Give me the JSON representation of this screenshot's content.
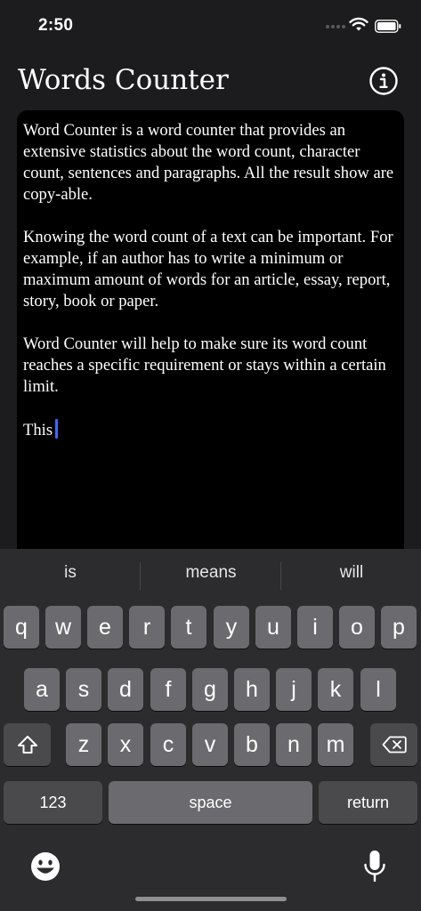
{
  "status_bar": {
    "time": "2:50"
  },
  "header": {
    "title": "Words Counter",
    "info_icon": "info-circle-icon"
  },
  "editor": {
    "paragraphs": [
      "Word Counter is a word counter that provides an extensive statistics about the word count, character count, sentences and paragraphs. All the result show are copy-able.",
      "Knowing the word count of a text can be important. For example, if an author has to write a minimum or maximum amount of words for an article, essay, report, story, book or paper.",
      "Word Counter will help to make sure its word count reaches a specific requirement or stays within a certain limit."
    ],
    "current_line": "This"
  },
  "keyboard": {
    "suggestions": [
      "is",
      "means",
      "will"
    ],
    "row1": [
      "q",
      "w",
      "e",
      "r",
      "t",
      "y",
      "u",
      "i",
      "o",
      "p"
    ],
    "row2": [
      "a",
      "s",
      "d",
      "f",
      "g",
      "h",
      "j",
      "k",
      "l"
    ],
    "row3": [
      "z",
      "x",
      "c",
      "v",
      "b",
      "n",
      "m"
    ],
    "numbers_label": "123",
    "space_label": "space",
    "return_label": "return",
    "shift_icon": "shift-icon",
    "delete_icon": "delete-icon",
    "emoji_icon": "emoji-icon",
    "mic_icon": "microphone-icon"
  },
  "colors": {
    "caret": "#3a6bff",
    "editor_bg": "#000000",
    "app_bg": "#1c1c1e",
    "keyboard_bg": "#2c2c2e"
  }
}
